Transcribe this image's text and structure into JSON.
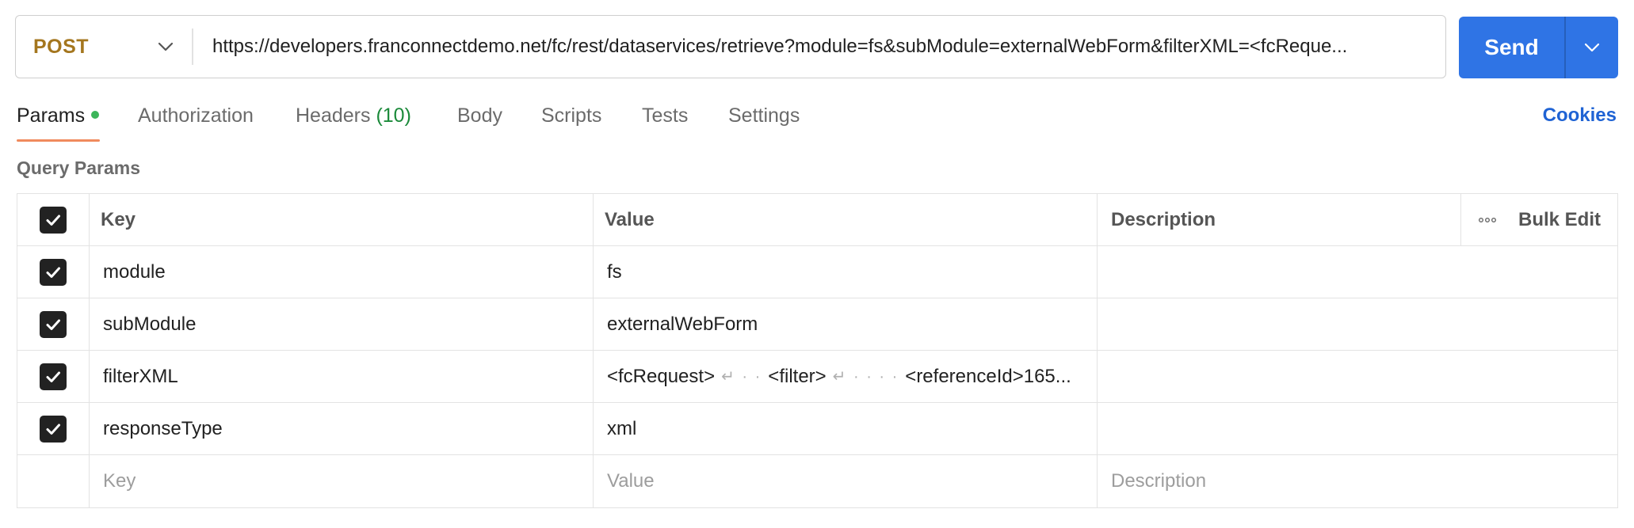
{
  "request": {
    "method": "POST",
    "url": "https://developers.franconnectdemo.net/fc/rest/dataservices/retrieve?module=fs&subModule=externalWebForm&filterXML=<fcReque...",
    "send_label": "Send"
  },
  "tabs": {
    "params": "Params",
    "authorization": "Authorization",
    "headers": "Headers",
    "headers_count": "(10)",
    "body": "Body",
    "scripts": "Scripts",
    "tests": "Tests",
    "settings": "Settings",
    "cookies": "Cookies"
  },
  "query_params": {
    "title": "Query Params",
    "columns": {
      "key": "Key",
      "value": "Value",
      "description": "Description",
      "bulk_edit": "Bulk Edit"
    },
    "rows": [
      {
        "key": "module",
        "value": "fs",
        "description": "",
        "checked": true
      },
      {
        "key": "subModule",
        "value": "externalWebForm",
        "description": "",
        "checked": true
      },
      {
        "key": "filterXML",
        "value_parts": [
          "<fcRequest>",
          "↵ · ·",
          "<filter>",
          "↵ · · · ·",
          "<referenceId>165..."
        ],
        "description": "",
        "checked": true
      },
      {
        "key": "responseType",
        "value": "xml",
        "description": "",
        "checked": true
      }
    ],
    "placeholders": {
      "key": "Key",
      "value": "Value",
      "description": "Description"
    }
  }
}
